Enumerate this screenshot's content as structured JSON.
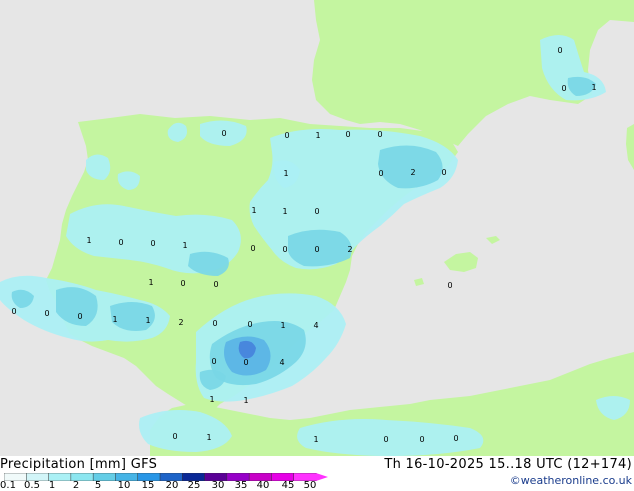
{
  "title_left": "Precipitation [mm] GFS",
  "title_right": "Th 16-10-2025 15..18 UTC (12+174)",
  "credit": "©weatheronline.co.uk",
  "colors": {
    "sea": "#e6e6e6",
    "land": "#c4f5a0",
    "precip_light": "#aaf0f5",
    "precip_mid": "#78d7e6",
    "precip_heavy": "#5ab4e6",
    "precip_core": "#4682dc"
  },
  "legend": {
    "ticks": [
      "0.1",
      "0.5",
      "1",
      "2",
      "5",
      "10",
      "15",
      "20",
      "25",
      "30",
      "35",
      "40",
      "45",
      "50"
    ],
    "colors": [
      "#f0fafa",
      "#d2f5f8",
      "#aaf0f5",
      "#8ce6f0",
      "#64cde6",
      "#46b4e6",
      "#2896e6",
      "#1e64c8",
      "#0a2896",
      "#5a0096",
      "#9600c8",
      "#c800c8",
      "#e600e6",
      "#ff32ff"
    ]
  },
  "labels": [
    {
      "t": "0"
    },
    {
      "t": "0"
    },
    {
      "t": "1"
    },
    {
      "t": "0"
    },
    {
      "t": "0"
    },
    {
      "t": "0"
    },
    {
      "t": "1"
    },
    {
      "t": "0"
    },
    {
      "t": "2"
    },
    {
      "t": "1"
    },
    {
      "t": "1"
    },
    {
      "t": "0"
    },
    {
      "t": "1"
    },
    {
      "t": "0"
    },
    {
      "t": "0"
    },
    {
      "t": "1"
    },
    {
      "t": "0"
    },
    {
      "t": "0"
    },
    {
      "t": "0"
    },
    {
      "t": "2"
    },
    {
      "t": "1"
    },
    {
      "t": "0"
    },
    {
      "t": "0"
    },
    {
      "t": "0"
    },
    {
      "t": "0"
    },
    {
      "t": "0"
    },
    {
      "t": "1"
    },
    {
      "t": "1"
    },
    {
      "t": "2"
    },
    {
      "t": "0"
    },
    {
      "t": "0"
    },
    {
      "t": "1"
    },
    {
      "t": "4"
    },
    {
      "t": "0"
    },
    {
      "t": "0"
    },
    {
      "t": "4"
    },
    {
      "t": "1"
    },
    {
      "t": "1"
    },
    {
      "t": "0"
    },
    {
      "t": "1"
    },
    {
      "t": "1"
    },
    {
      "t": "0"
    },
    {
      "t": "0"
    },
    {
      "t": "0"
    },
    {
      "t": "0"
    },
    {
      "t": "0"
    },
    {
      "t": "1"
    },
    {
      "t": "0"
    }
  ]
}
